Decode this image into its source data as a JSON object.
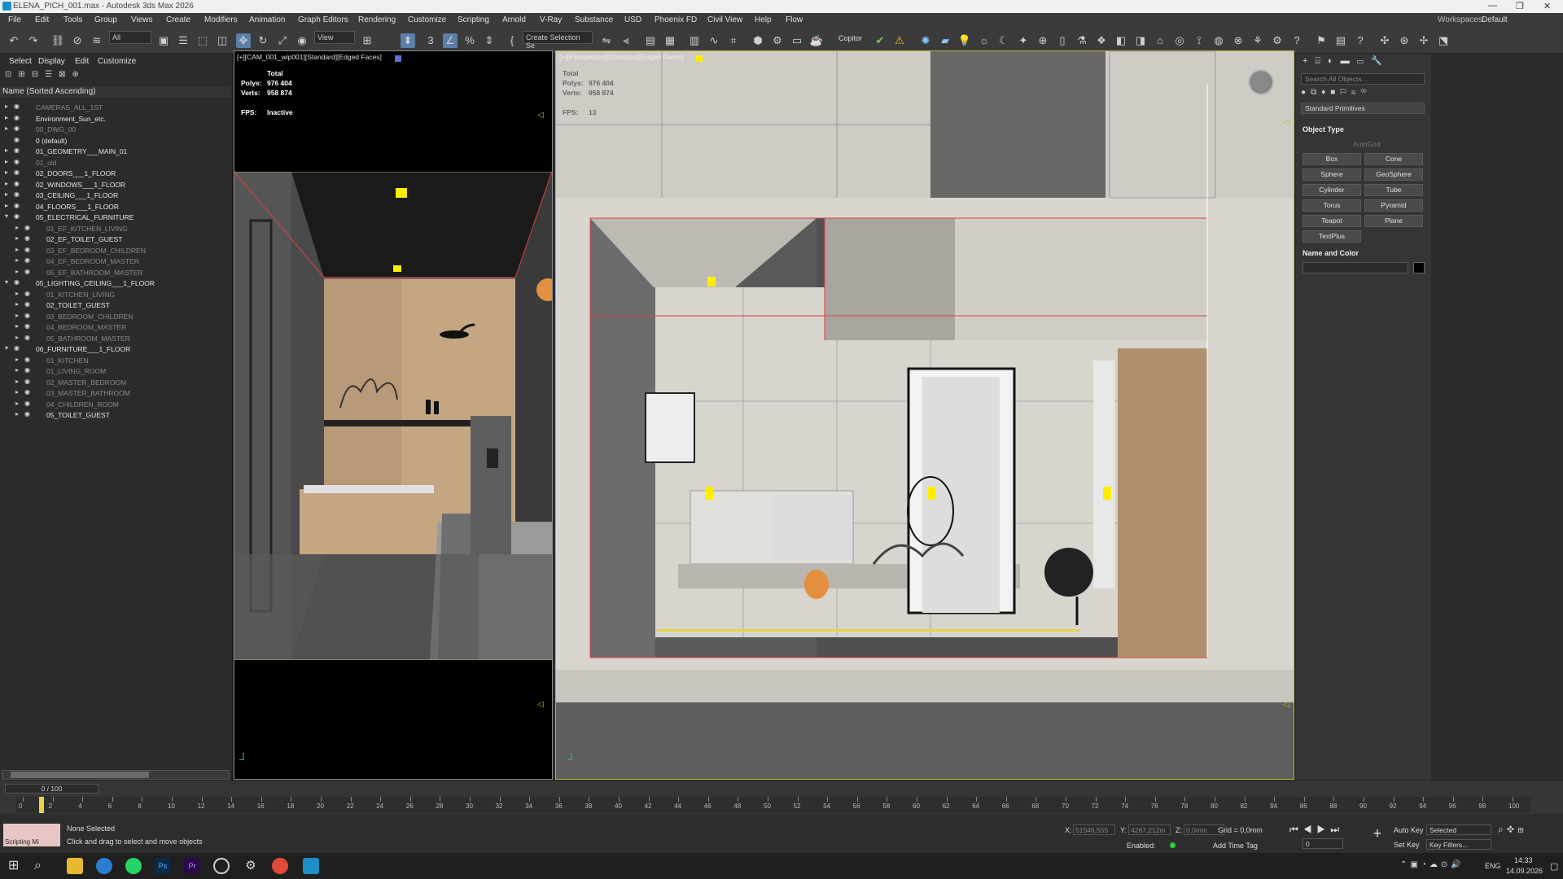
{
  "window": {
    "title": "ELENA_PICH_001.max - Autodesk 3ds Max 2026",
    "minimize": "—",
    "restore": "❐",
    "close": "✕"
  },
  "menu": [
    "File",
    "Edit",
    "Tools",
    "Group",
    "Views",
    "Create",
    "Modifiers",
    "Animation",
    "Graph Editors",
    "Rendering",
    "Customize",
    "Scripting",
    "Arnold",
    "V-Ray",
    "Substance",
    "USD",
    "Phoenix FD",
    "Civil View",
    "Help",
    "Flow"
  ],
  "workspace": {
    "label": "Workspaces:",
    "value": "Default"
  },
  "toolbar": {
    "filter": "All",
    "refcoord": "View",
    "selection_set": "Create Selection Se",
    "copitor": "Copitor",
    "icons": [
      "undo-icon",
      "redo-icon",
      "link-icon",
      "unlink-icon",
      "bind-space-warp-icon",
      "select-object-icon",
      "select-by-name-icon",
      "rect-region-icon",
      "window-crossing-icon",
      "move-icon",
      "rotate-icon",
      "scale-icon",
      "pivot-icon",
      "snap-icon",
      "angle-snap-icon",
      "percent-snap-icon",
      "spinner-snap-icon",
      "mirror-icon",
      "align-icon",
      "layer-explorer-icon",
      "scene-explorer-icon",
      "toggle-ribbon-icon",
      "curve-editor-icon",
      "schematic-view-icon",
      "material-editor-icon",
      "render-setup-icon",
      "render-frame-icon",
      "render-icon"
    ]
  },
  "scene_explorer": {
    "tabs": [
      "Select",
      "Display",
      "Edit",
      "Customize"
    ],
    "sort_header": "Name (Sorted Ascending)",
    "rows": [
      {
        "label": "CAMERAS_ALL_1ST",
        "level": 0,
        "arrow": "▸",
        "dim": true
      },
      {
        "label": "Environment_Sun_etc.",
        "level": 0,
        "arrow": "▸",
        "dim": false
      },
      {
        "label": "00_DWG_00",
        "level": 0,
        "arrow": "▸",
        "dim": true
      },
      {
        "label": "0 (default)",
        "level": 0,
        "arrow": "",
        "dim": false
      },
      {
        "label": "01_GEOMETRY___MAIN_01",
        "level": 0,
        "arrow": "▸",
        "dim": false
      },
      {
        "label": "01_old",
        "level": 0,
        "arrow": "▸",
        "dim": true
      },
      {
        "label": "02_DOORS___1_FLOOR",
        "level": 0,
        "arrow": "▸",
        "dim": false
      },
      {
        "label": "02_WINDOWS___1_FLOOR",
        "level": 0,
        "arrow": "▸",
        "dim": false
      },
      {
        "label": "03_CEILING___1_FLOOR",
        "level": 0,
        "arrow": "▸",
        "dim": false
      },
      {
        "label": "04_FLOORS___1_FLOOR",
        "level": 0,
        "arrow": "▸",
        "dim": false
      },
      {
        "label": "05_ELECTRICAL_FURNITURE",
        "level": 0,
        "arrow": "▾",
        "dim": false
      },
      {
        "label": "01_EF_KITCHEN_LIVING",
        "level": 1,
        "arrow": "▸",
        "dim": true
      },
      {
        "label": "02_EF_TOILET_GUEST",
        "level": 1,
        "arrow": "▸",
        "dim": false
      },
      {
        "label": "03_EF_BEDROOM_CHILDREN",
        "level": 1,
        "arrow": "▸",
        "dim": true
      },
      {
        "label": "04_EF_BEDROOM_MASTER",
        "level": 1,
        "arrow": "▸",
        "dim": true
      },
      {
        "label": "05_EF_BATHROOM_MASTER",
        "level": 1,
        "arrow": "▸",
        "dim": true
      },
      {
        "label": "05_LIGHTING_CEILING___1_FLOOR",
        "level": 0,
        "arrow": "▾",
        "dim": false
      },
      {
        "label": "01_KITCHEN_LIVING",
        "level": 1,
        "arrow": "▸",
        "dim": true
      },
      {
        "label": "02_TOILET_GUEST",
        "level": 1,
        "arrow": "▸",
        "dim": false
      },
      {
        "label": "03_BEDROOM_CHILDREN",
        "level": 1,
        "arrow": "▸",
        "dim": true
      },
      {
        "label": "04_BEDROOM_MASTER",
        "level": 1,
        "arrow": "▸",
        "dim": true
      },
      {
        "label": "05_BATHROOM_MASTER",
        "level": 1,
        "arrow": "▸",
        "dim": true
      },
      {
        "label": "06_FURNITURE___1_FLOOR",
        "level": 0,
        "arrow": "▾",
        "dim": false
      },
      {
        "label": "01_KITCHEN",
        "level": 1,
        "arrow": "▸",
        "dim": true
      },
      {
        "label": "01_LIVING_ROOM",
        "level": 1,
        "arrow": "▸",
        "dim": true
      },
      {
        "label": "02_MASTER_BEDROOM",
        "level": 1,
        "arrow": "▸",
        "dim": true
      },
      {
        "label": "03_MASTER_BATHROOM",
        "level": 1,
        "arrow": "▸",
        "dim": true
      },
      {
        "label": "04_CHILDREN_ROOM",
        "level": 1,
        "arrow": "▸",
        "dim": true
      },
      {
        "label": "05_TOILET_GUEST",
        "level": 1,
        "arrow": "▸",
        "dim": false
      }
    ]
  },
  "viewport_left": {
    "header": "[+][CAM_001_wip001][Standard][Edged Faces]",
    "total": "Total",
    "polys_label": "Polys:",
    "polys": "976 404",
    "verts_label": "Verts:",
    "verts": "958 874",
    "fps_label": "FPS:",
    "fps": "Inactive"
  },
  "viewport_right": {
    "header": "[+][Perspective][Standard][Edged Faces]",
    "total": "Total",
    "polys_label": "Polys:",
    "polys": "976 404",
    "verts_label": "Verts:",
    "verts": "958 874",
    "fps_label": "FPS:",
    "fps": "13"
  },
  "command_panel": {
    "search_placeholder": "Search All Objects...",
    "category": "Standard Primitives",
    "object_type_title": "Object Type",
    "autogrid": "AutoGrid",
    "buttons": [
      "Box",
      "Cone",
      "Sphere",
      "GeoSphere",
      "Cylinder",
      "Tube",
      "Torus",
      "Pyramid",
      "Teapot",
      "Plane",
      "TextPlus"
    ],
    "name_color_title": "Name and Color"
  },
  "timeline": {
    "frame_display": "0 / 100",
    "ticks": [
      "0",
      "2",
      "4",
      "6",
      "8",
      "10",
      "12",
      "14",
      "16",
      "18",
      "20",
      "22",
      "24",
      "26",
      "28",
      "30",
      "32",
      "34",
      "36",
      "38",
      "40",
      "42",
      "44",
      "46",
      "48",
      "50",
      "52",
      "54",
      "56",
      "58",
      "60",
      "62",
      "64",
      "66",
      "68",
      "70",
      "72",
      "74",
      "76",
      "78",
      "80",
      "82",
      "84",
      "86",
      "88",
      "90",
      "92",
      "94",
      "96",
      "98",
      "100"
    ]
  },
  "status": {
    "script_label": "Scripting Mi",
    "selection": "None Selected",
    "prompt": "Click and drag to select and move objects",
    "x_label": "X:",
    "x": "51546,555",
    "y_label": "Y:",
    "y": "4267,212m",
    "z_label": "Z:",
    "z": "0,0mm",
    "grid": "Grid = 0,0mm",
    "enabled": "Enabled:",
    "add_time_tag": "Add Time Tag",
    "auto_key": "Auto Key",
    "set_key": "Set Key",
    "selected": "Selected",
    "key_filters": "Key Filters...",
    "frame": "0"
  },
  "taskbar": {
    "lang": "ENG",
    "time": "14:33",
    "date": "14.09.2026"
  }
}
